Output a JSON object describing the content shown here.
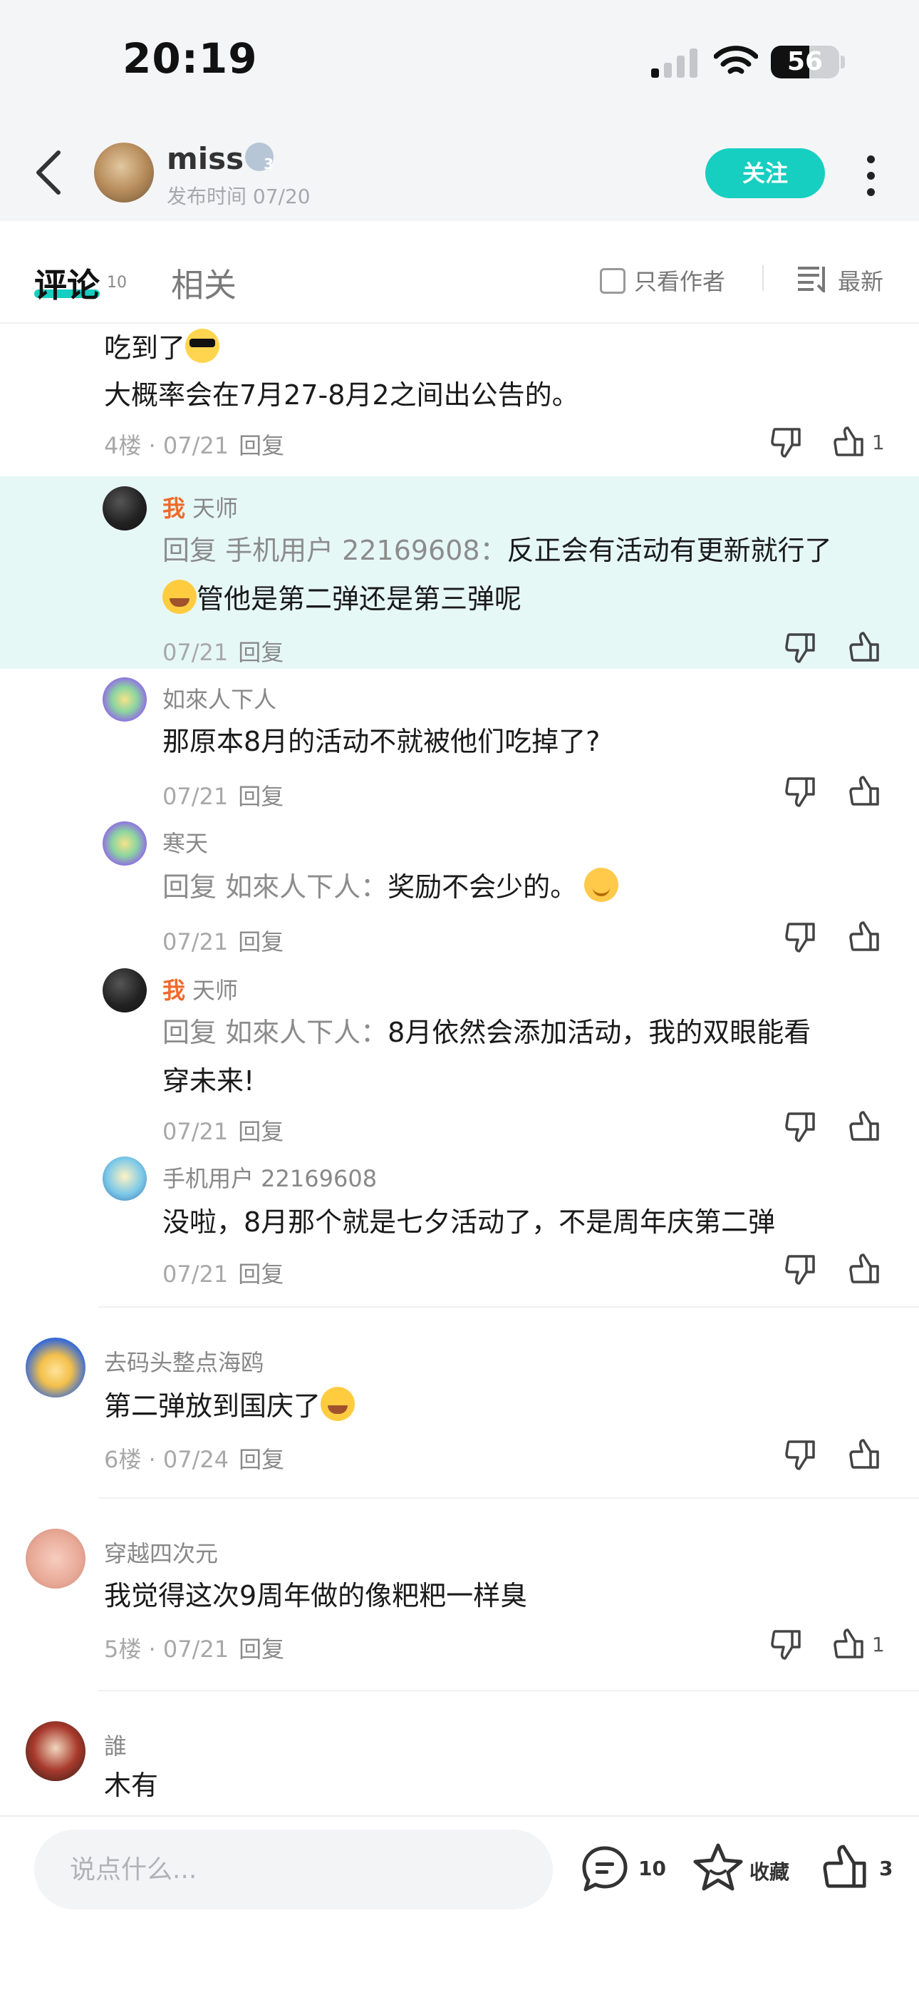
{
  "status_bar": {
    "time": "20:19",
    "battery": "56",
    "battery_level": 0.56
  },
  "header": {
    "user_name": "miss",
    "badge_level": "3",
    "publish_time": "发布时间 07/20",
    "follow_label": "关注"
  },
  "tabs": {
    "comments": "评论",
    "comments_count": "10",
    "related": "相关",
    "author_only": "只看作者",
    "sort": "最新"
  },
  "comments": [
    {
      "text_line1": "吃到了",
      "text_line2": "大概率会在7月27-8月2之间出公告的。",
      "floor_date": "4楼 · 07/21",
      "reply": "回复",
      "like_count": "1"
    },
    {
      "me": "我",
      "name": "天师",
      "reply_prefix": "回复 手机用户 22169608：",
      "text_a": "反正会有活动有更新就行了",
      "text_b": "管他是第二弹还是第三弹呢",
      "date": "07/21",
      "reply": "回复"
    },
    {
      "name": "如來人下人",
      "text": "那原本8月的活动不就被他们吃掉了?",
      "date": "07/21",
      "reply": "回复"
    },
    {
      "name": "寒天",
      "reply_prefix": "回复 如來人下人：",
      "text": "奖励不会少的。",
      "date": "07/21",
      "reply": "回复"
    },
    {
      "me": "我",
      "name": "天师",
      "reply_prefix": "回复 如來人下人：",
      "text_a": "8月依然会添加活动，我的双眼能看",
      "text_b": "穿未来!",
      "date": "07/21",
      "reply": "回复"
    },
    {
      "name": "手机用户 22169608",
      "text": "没啦，8月那个就是七夕活动了，不是周年庆第二弹",
      "date": "07/21",
      "reply": "回复"
    },
    {
      "name": "去码头整点海鸥",
      "text": "第二弹放到国庆了",
      "floor_date": "6楼 · 07/24",
      "reply": "回复"
    },
    {
      "name": "穿越四次元",
      "text": "我觉得这次9周年做的像粑粑一样臭",
      "floor_date": "5楼 · 07/21",
      "reply": "回复",
      "like_count": "1"
    },
    {
      "name": "誰",
      "text": "木有"
    }
  ],
  "bottom": {
    "placeholder": "说点什么...",
    "comment_count": "10",
    "favorite_label": "收藏",
    "like_count": "3"
  },
  "colors": {
    "accent": "#16cfc1",
    "highlight": "#e6f8f6",
    "me": "#f06a2b"
  },
  "icons": [
    "back-icon",
    "signal-icon",
    "wifi-icon",
    "battery-icon",
    "more-icon",
    "checkbox-icon",
    "sort-icon",
    "dislike-icon",
    "like-icon",
    "comment-icon",
    "star-icon"
  ]
}
